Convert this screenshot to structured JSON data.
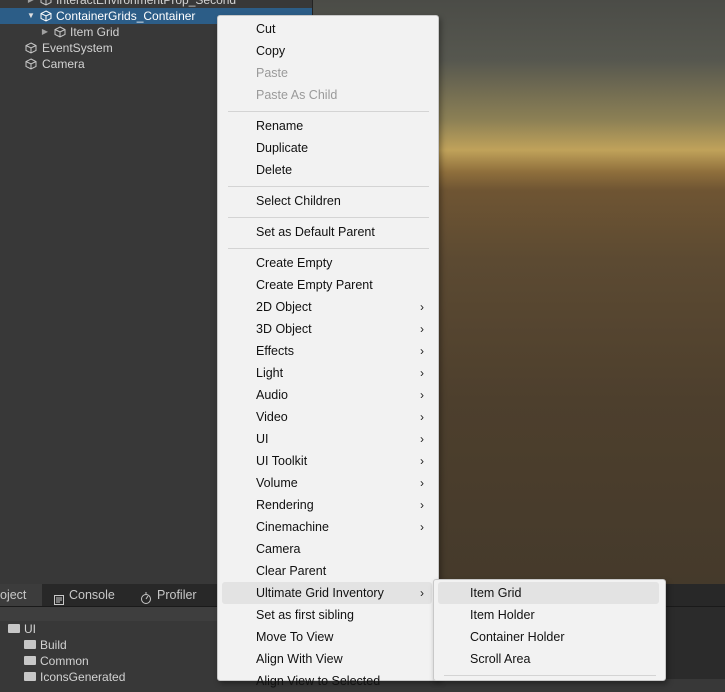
{
  "hierarchy": {
    "items": [
      {
        "label": "InteractEnvironmentProp_Second"
      },
      {
        "label": "ContainerGrids_Container"
      },
      {
        "label": "Item Grid"
      },
      {
        "label": "EventSystem"
      },
      {
        "label": "Camera"
      }
    ]
  },
  "bottom_tabs": {
    "project": "oject",
    "console": "Console",
    "profiler": "Profiler"
  },
  "project": {
    "items": [
      {
        "label": "UI"
      },
      {
        "label": "Build"
      },
      {
        "label": "Common"
      },
      {
        "label": "IconsGenerated"
      }
    ]
  },
  "context_menu": {
    "cut": "Cut",
    "copy": "Copy",
    "paste": "Paste",
    "paste_as_child": "Paste As Child",
    "rename": "Rename",
    "duplicate": "Duplicate",
    "delete": "Delete",
    "select_children": "Select Children",
    "set_default_parent": "Set as Default Parent",
    "create_empty": "Create Empty",
    "create_empty_parent": "Create Empty Parent",
    "object_2d": "2D Object",
    "object_3d": "3D Object",
    "effects": "Effects",
    "light": "Light",
    "audio": "Audio",
    "video": "Video",
    "ui": "UI",
    "ui_toolkit": "UI Toolkit",
    "volume": "Volume",
    "rendering": "Rendering",
    "cinemachine": "Cinemachine",
    "camera": "Camera",
    "clear_parent": "Clear Parent",
    "ultimate_grid_inventory": "Ultimate Grid Inventory",
    "set_first_sibling": "Set as first sibling",
    "move_to_view": "Move To View",
    "align_with_view": "Align With View",
    "align_view_to_selected": "Align View to Selected"
  },
  "submenu": {
    "item_grid": "Item Grid",
    "item_holder": "Item Holder",
    "container_holder": "Container Holder",
    "scroll_area": "Scroll Area"
  },
  "colors": {
    "selection": "#2c5d87",
    "menu_bg": "#f2f2f2",
    "panel_bg": "#383838"
  }
}
